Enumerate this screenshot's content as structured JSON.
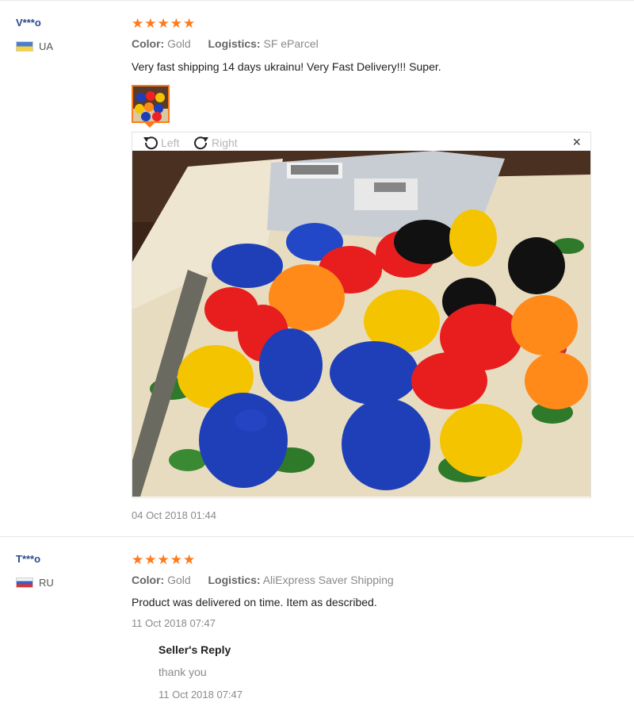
{
  "reviews": [
    {
      "user": "V***o",
      "country": "UA",
      "rating": 5,
      "color_label": "Color:",
      "color_value": "Gold",
      "logistics_label": "Logistics:",
      "logistics_value": "SF eParcel",
      "text": "Very fast shipping 14 days ukrainu! Very Fast Delivery!!! Super.",
      "date": "04 Oct 2018 01:44",
      "viewer": {
        "rotate_left": "Left",
        "rotate_right": "Right",
        "close": "×"
      }
    },
    {
      "user": "T***o",
      "country": "RU",
      "rating": 5,
      "color_label": "Color:",
      "color_value": "Gold",
      "logistics_label": "Logistics:",
      "logistics_value": "AliExpress Saver Shipping",
      "text": "Product was delivered on time. Item as described.",
      "date": "11 Oct 2018 07:47",
      "seller_reply": {
        "title": "Seller's Reply",
        "text": "thank you",
        "date": "11 Oct 2018 07:47"
      }
    }
  ],
  "colors": {
    "star": "#ff7a1a",
    "username": "#2a4a8a",
    "muted": "#8a8a8a"
  }
}
